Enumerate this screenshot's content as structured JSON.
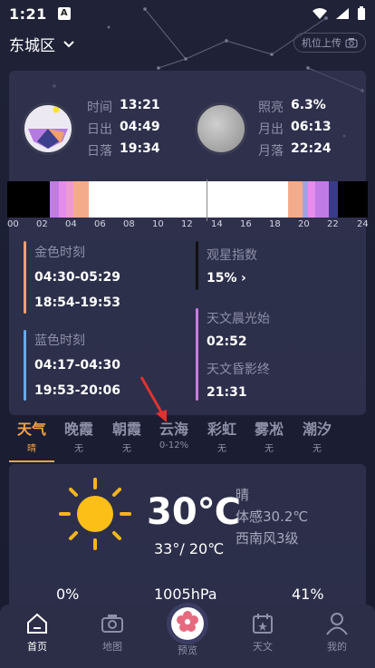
{
  "status_bar": {
    "time": "1:21",
    "a_icon": "A"
  },
  "header": {
    "district": "东城区",
    "upload_label": "机位上传"
  },
  "sun": {
    "rows": [
      {
        "k": "时间",
        "v": "13:21"
      },
      {
        "k": "日出",
        "v": "04:49"
      },
      {
        "k": "日落",
        "v": "19:34"
      }
    ]
  },
  "moon": {
    "rows": [
      {
        "k": "照亮",
        "v": "6.3%"
      },
      {
        "k": "月出",
        "v": "06:13"
      },
      {
        "k": "月落",
        "v": "22:24"
      }
    ]
  },
  "timeline_ticks": [
    "00",
    "02",
    "04",
    "06",
    "08",
    "10",
    "12",
    "14",
    "16",
    "18",
    "20",
    "22",
    "24"
  ],
  "golden": {
    "label": "金色时刻",
    "morning": "04:30-05:29",
    "evening": "18:54-19:53"
  },
  "blue": {
    "label": "蓝色时刻",
    "morning": "04:17-04:30",
    "evening": "19:53-20:06"
  },
  "seeing": {
    "label": "观星指数",
    "value": "15%",
    "chevron": "›"
  },
  "astro": {
    "dawn_label": "天文晨光始",
    "dawn": "02:52",
    "dusk_label": "天文昏影终",
    "dusk": "21:31"
  },
  "tabs": [
    {
      "t": "天气",
      "s": "晴"
    },
    {
      "t": "晚霞",
      "s": "无"
    },
    {
      "t": "朝霞",
      "s": "无"
    },
    {
      "t": "云海",
      "s": "0-12%"
    },
    {
      "t": "彩虹",
      "s": "无"
    },
    {
      "t": "雾凇",
      "s": "无"
    },
    {
      "t": "潮汐",
      "s": "无"
    }
  ],
  "weather": {
    "temp": "30℃",
    "range": "33°/ 20℃",
    "cond": "晴",
    "feel": "体感30.2℃",
    "wind": "西南风3级",
    "v1": "0%",
    "v2": "1005hPa",
    "v3": "41%"
  },
  "nav": [
    {
      "label": "首页",
      "icon": "home-icon"
    },
    {
      "label": "地图",
      "icon": "camera-icon"
    },
    {
      "label": "预览",
      "icon": "flower-icon"
    },
    {
      "label": "天文",
      "icon": "calendar-icon"
    },
    {
      "label": "我的",
      "icon": "user-icon"
    }
  ],
  "colors": {
    "accent": "#f4a24a",
    "golden": "#f0a06a",
    "blue": "#69a9e8",
    "violet": "#c87be0"
  }
}
